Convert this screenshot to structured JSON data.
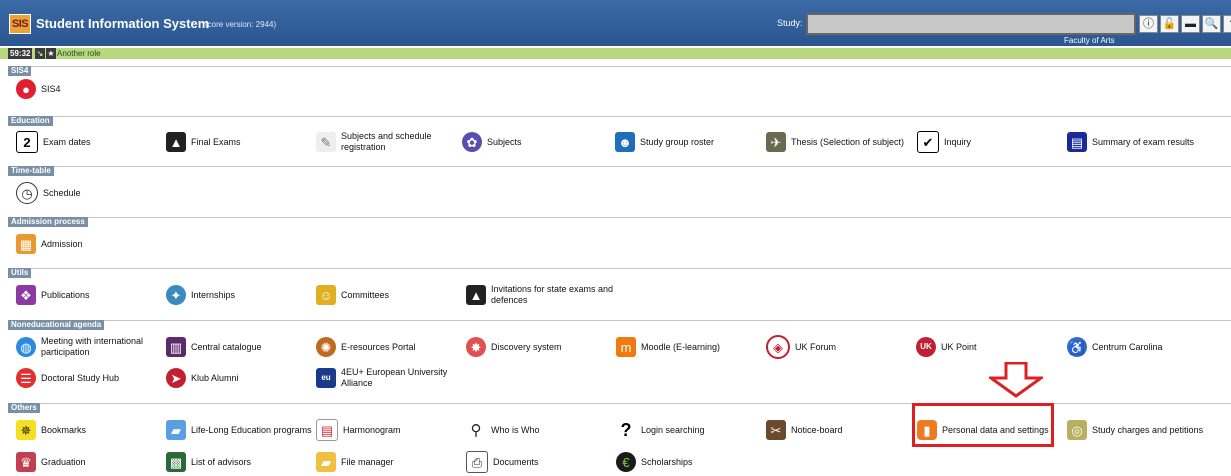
{
  "header": {
    "logo": "SIS",
    "title": "Student Information System",
    "core_version": "(core version: 2944)",
    "study_label": "Study:",
    "study_value": "",
    "faculty": "Faculty of Arts"
  },
  "rolebar": {
    "timer": "59:32",
    "another_role": "Another role"
  },
  "colors": {
    "header": "#2e5c97",
    "rolebar": "#b8d77e",
    "section_label": "#788fa6",
    "highlight": "#e02020"
  },
  "sections": {
    "sis4": {
      "label": "SIS4",
      "items": [
        "SIS4"
      ]
    },
    "education": {
      "label": "Education",
      "items": [
        "Exam dates",
        "Final Exams",
        "Subjects and schedule registration",
        "Subjects",
        "Study group roster",
        "Thesis (Selection of subject)",
        "Inquiry",
        "Summary of exam results"
      ]
    },
    "timetable": {
      "label": "Time-table",
      "items": [
        "Schedule"
      ]
    },
    "admission": {
      "label": "Admission process",
      "items": [
        "Admission"
      ]
    },
    "utils": {
      "label": "Utils",
      "items": [
        "Publications",
        "Internships",
        "Committees",
        "Invitations for state exams and defences"
      ]
    },
    "noneducational": {
      "label": "Noneducational agenda",
      "items": [
        "Meeting with international participation",
        "Central catalogue",
        "E-resources Portal",
        "Discovery system",
        "Moodle (E-learning)",
        "UK Forum",
        "UK Point",
        "Centrum Carolina",
        "Doctoral Study Hub",
        "Klub Alumni",
        "4EU+ European University Alliance"
      ]
    },
    "others": {
      "label": "Others",
      "items": [
        "Bookmarks",
        "Life-Long Education programs",
        "Harmonogram",
        "Who is Who",
        "Login searching",
        "Notice-board",
        "Personal data and settings",
        "Study charges and petitions",
        "Graduation",
        "List of advisors",
        "File manager",
        "Documents",
        "Scholarships"
      ]
    }
  },
  "icons": {
    "sis4": "sis4-button-icon",
    "exam_dates": "calendar-icon",
    "final_exams": "graduation-cap-icon",
    "subjects_registration": "pencil-icon",
    "subjects": "knot-icon",
    "roster": "people-icon",
    "thesis": "eagle-icon",
    "inquiry": "checkbox-icon",
    "summary": "index-book-icon",
    "schedule": "clock-icon",
    "admission": "form-icon",
    "publications": "books-icon",
    "internships": "globe-icon",
    "committees": "group-icon",
    "invitations": "cap-icon",
    "highlight": "down-arrow-icon"
  }
}
